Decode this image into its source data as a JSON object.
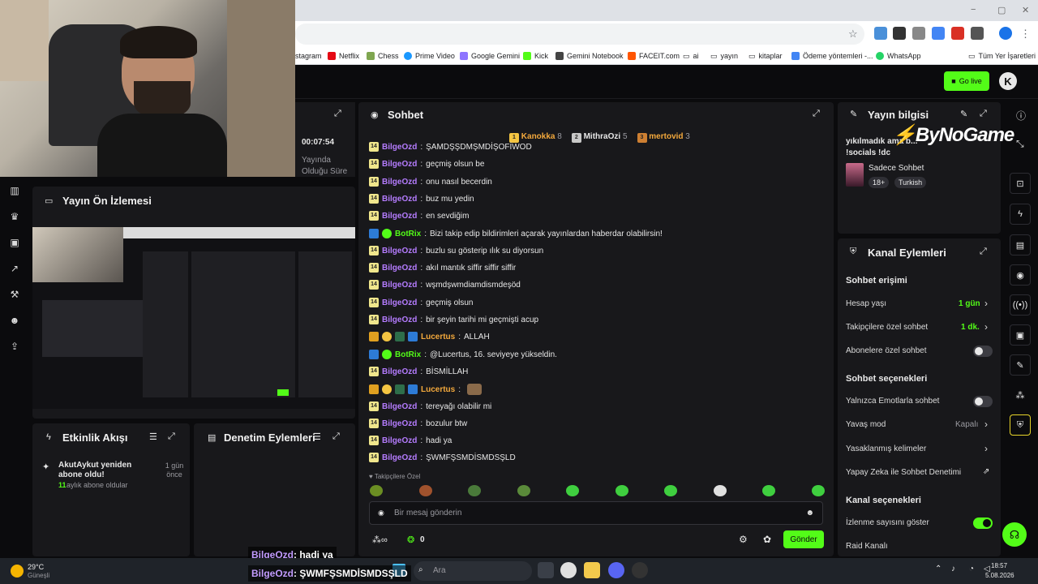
{
  "browser": {
    "bookmarks": [
      "stagram",
      "Netflix",
      "Chess",
      "Prime Video",
      "Google Gemini",
      "Kick",
      "Gemini Notebook",
      "FACEIT.com",
      "ai",
      "yayın",
      "kitaplar",
      "Ödeme yöntemleri -...",
      "WhatsApp",
      "Tüm Yer İşaretleri"
    ],
    "window_controls": [
      "−",
      "▢",
      "✕"
    ]
  },
  "topbar": {
    "go_live": "Go live",
    "logo": "K"
  },
  "stream_info": {
    "timer": "00:07:54",
    "timer_label": "Yayında Olduğu Süre"
  },
  "preview": {
    "title": "Yayın Ön İzlemesi"
  },
  "activity": {
    "title": "Etkinlik Akışı",
    "item_title": "AkutAykut yeniden abone oldu!",
    "item_count": "11",
    "item_sub": "aylık abone oldular",
    "item_time": "1 gün önce"
  },
  "moderation": {
    "title": "Denetim Eylemleri"
  },
  "chat": {
    "title": "Sohbet",
    "top": [
      {
        "name": "Kanokka",
        "count": "8"
      },
      {
        "name": "MithraOzi",
        "count": "5"
      },
      {
        "name": "mertovid",
        "count": "3"
      }
    ],
    "messages": [
      {
        "user": "BilgeOzd",
        "text": "ŞAMDŞŞDMŞMDİŞOFİWOD",
        "type": "sub"
      },
      {
        "user": "BilgeOzd",
        "text": "geçmiş olsun be",
        "type": "sub"
      },
      {
        "user": "BilgeOzd",
        "text": "onu nasıl becerdin",
        "type": "sub"
      },
      {
        "user": "BilgeOzd",
        "text": "buz mu yedin",
        "type": "sub"
      },
      {
        "user": "BilgeOzd",
        "text": "en sevdiğim",
        "type": "sub"
      },
      {
        "user": "BotRix",
        "text": "Bizi takip edip bildirimleri açarak yayınlardan haberdar olabilirsin!",
        "type": "bot"
      },
      {
        "user": "BilgeOzd",
        "text": "buzlu su gösterip ılık su diyorsun",
        "type": "sub"
      },
      {
        "user": "BilgeOzd",
        "text": "akıl mantık siffir siffir siffir",
        "type": "sub"
      },
      {
        "user": "BilgeOzd",
        "text": "wşmdşwmdiamdismdeşöd",
        "type": "sub"
      },
      {
        "user": "BilgeOzd",
        "text": "geçmiş olsun",
        "type": "sub"
      },
      {
        "user": "BilgeOzd",
        "text": "bir şeyin tarihi mi geçmişti acup",
        "type": "sub"
      },
      {
        "user": "Lucertus",
        "text": "ALLAH",
        "type": "vip"
      },
      {
        "user": "BotRix",
        "text": "@Lucertus, 16. seviyeye yükseldin.",
        "type": "bot"
      },
      {
        "user": "BilgeOzd",
        "text": "BİSMİLLAH",
        "type": "sub"
      },
      {
        "user": "Lucertus",
        "text": "",
        "type": "vip"
      },
      {
        "user": "BilgeOzd",
        "text": "tereyağı olabilir mi",
        "type": "sub"
      },
      {
        "user": "BilgeOzd",
        "text": "bozulur btw",
        "type": "sub"
      },
      {
        "user": "BilgeOzd",
        "text": "hadi ya",
        "type": "sub"
      },
      {
        "user": "BilgeOzd",
        "text": "ŞWMFŞSMDİSMDSŞLD",
        "type": "sub"
      }
    ],
    "sub_badge": "14",
    "followers_only": "Takipçilere Özel",
    "input_placeholder": "Bir mesaj gönderin",
    "points": "0",
    "send": "Gönder"
  },
  "overlay": {
    "line1_user": "BilgeOzd",
    "line1_text": ": hadi ya",
    "line2_user": "BilgeOzd",
    "line2_text": ": ŞWMFŞSMDİSMDSŞLD",
    "brand": "ByNoGame"
  },
  "stream_panel": {
    "title": "Yayın bilgisi",
    "stream_title": "yıkılmadık ama b...",
    "stream_title2": "!socials !dc",
    "category": "Sadece Sohbet",
    "tags": [
      "18+",
      "Turkish"
    ]
  },
  "channel_actions": {
    "title": "Kanal Eylemleri",
    "chat_access": "Sohbet erişimi",
    "account_age": "Hesap yaşı",
    "account_age_val": "1 gün",
    "followers_chat": "Takipçilere özel sohbet",
    "followers_chat_val": "1 dk.",
    "subs_chat": "Abonelere özel sohbet",
    "chat_options": "Sohbet seçenekleri",
    "emote_only": "Yalnızca Emotlarla sohbet",
    "slow_mode": "Yavaş mod",
    "slow_mode_val": "Kapalı",
    "banned_words": "Yasaklanmış kelimeler",
    "ai_mod": "Yapay Zeka ile Sohbet Denetimi",
    "channel_options": "Kanal seçenekleri",
    "show_views": "İzlenme sayısını göster",
    "raid": "Raid Kanalı"
  },
  "taskbar": {
    "weather_temp": "29°C",
    "weather_desc": "Güneşli",
    "search": "Ara",
    "time": "18:57",
    "date": "5.08.2026"
  }
}
